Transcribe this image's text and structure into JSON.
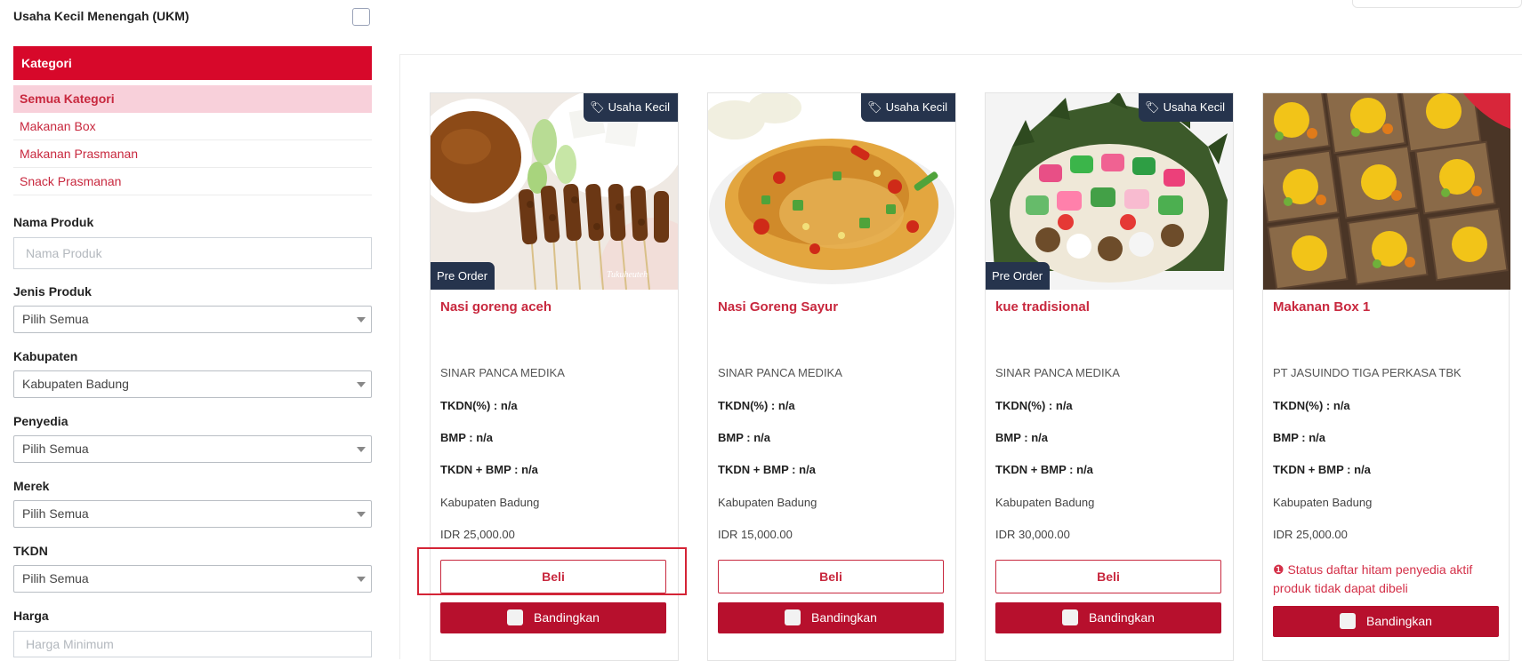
{
  "filters": {
    "ukm_label": "Usaha Kecil Menengah (UKM)",
    "category_header": "Kategori",
    "categories": [
      "Semua Kategori",
      "Makanan Box",
      "Makanan Prasmanan",
      "Snack Prasmanan"
    ],
    "nama_produk_label": "Nama Produk",
    "nama_produk_placeholder": "Nama Produk",
    "jenis_produk_label": "Jenis Produk",
    "jenis_produk_value": "Pilih Semua",
    "kabupaten_label": "Kabupaten",
    "kabupaten_value": "Kabupaten Badung",
    "penyedia_label": "Penyedia",
    "penyedia_value": "Pilih Semua",
    "merek_label": "Merek",
    "merek_value": "Pilih Semua",
    "tkdn_label": "TKDN",
    "tkdn_value": "Pilih Semua",
    "harga_label": "Harga",
    "harga_min_placeholder": "Harga Minimum"
  },
  "products": [
    {
      "name": "Nasi goreng aceh",
      "badge": "Usaha Kecil",
      "preorder": "Pre Order",
      "seller": "SINAR PANCA MEDIKA",
      "tkdn": "TKDN(%) : n/a",
      "bmp": "BMP : n/a",
      "tkdn_bmp": "TKDN + BMP : n/a",
      "location": "Kabupaten Badung",
      "price": "IDR 25,000.00",
      "buy_label": "Beli",
      "compare_label": "Bandingkan",
      "image_caption": "Tukuheuteh"
    },
    {
      "name": "Nasi Goreng Sayur",
      "badge": "Usaha Kecil",
      "seller": "SINAR PANCA MEDIKA",
      "tkdn": "TKDN(%) : n/a",
      "bmp": "BMP : n/a",
      "tkdn_bmp": "TKDN + BMP : n/a",
      "location": "Kabupaten Badung",
      "price": "IDR 15,000.00",
      "buy_label": "Beli",
      "compare_label": "Bandingkan"
    },
    {
      "name": "kue tradisional",
      "badge": "Usaha Kecil",
      "preorder": "Pre Order",
      "seller": "SINAR PANCA MEDIKA",
      "tkdn": "TKDN(%) : n/a",
      "bmp": "BMP : n/a",
      "tkdn_bmp": "TKDN + BMP : n/a",
      "location": "Kabupaten Badung",
      "price": "IDR 30,000.00",
      "buy_label": "Beli",
      "compare_label": "Bandingkan"
    },
    {
      "name": "Makanan Box 1",
      "seller": "PT JASUINDO TIGA PERKASA TBK",
      "tkdn": "TKDN(%) : n/a",
      "bmp": "BMP : n/a",
      "tkdn_bmp": "TKDN + BMP : n/a",
      "location": "Kabupaten Badung",
      "price": "IDR 25,000.00",
      "status_warning": "Status daftar hitam penyedia aktif produk tidak dapat dibeli",
      "compare_label": "Bandingkan"
    }
  ],
  "icons": {
    "tag": "tag-icon",
    "info": "info-circle-icon",
    "caret": "caret-down-icon"
  },
  "colors": {
    "accent_red": "#d7082a",
    "compare_bg": "#b7102d",
    "badge_navy": "#26344d",
    "active_category_bg": "#f8d0da"
  }
}
